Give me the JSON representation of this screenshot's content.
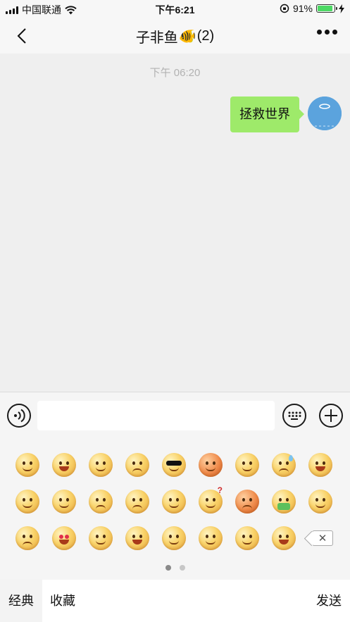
{
  "status_bar": {
    "carrier": "中国联通",
    "time": "下午6:21",
    "battery_percent_text": "91%",
    "battery_level": 0.91
  },
  "nav": {
    "title": "子非鱼",
    "title_emoji": "🐠",
    "member_count": "(2)"
  },
  "chat": {
    "timestamp": "下午 06:20",
    "messages": [
      {
        "text": "拯救世界",
        "from": "me"
      }
    ]
  },
  "input": {
    "value": "",
    "placeholder": ""
  },
  "emoji_panel": {
    "page_count": 2,
    "active_page": 1
  },
  "bottom": {
    "tab_classic": "经典",
    "tab_favorites": "收藏",
    "send_label": "发送"
  },
  "colors": {
    "bubble": "#9eea6a",
    "battery": "#4cd964",
    "avatar": "#5ba3dd"
  }
}
